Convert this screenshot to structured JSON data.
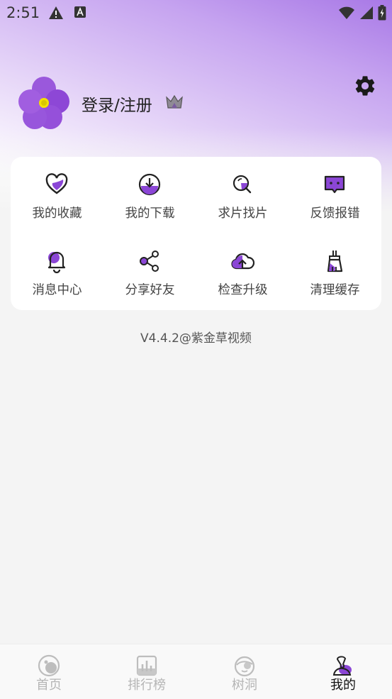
{
  "status_bar": {
    "time": "2:51"
  },
  "profile": {
    "login_label": "登录/注册"
  },
  "menu": {
    "items": [
      {
        "label": "我的收藏",
        "icon": "heart-icon"
      },
      {
        "label": "我的下载",
        "icon": "download-icon"
      },
      {
        "label": "求片找片",
        "icon": "search-film-icon"
      },
      {
        "label": "反馈报错",
        "icon": "feedback-icon"
      },
      {
        "label": "消息中心",
        "icon": "bell-icon"
      },
      {
        "label": "分享好友",
        "icon": "share-icon"
      },
      {
        "label": "检查升级",
        "icon": "cloud-upload-icon"
      },
      {
        "label": "清理缓存",
        "icon": "broom-icon"
      }
    ]
  },
  "version": "V4.4.2@紫金草视频",
  "tabbar": {
    "tabs": [
      {
        "label": "首页",
        "icon": "home-icon"
      },
      {
        "label": "排行榜",
        "icon": "ranking-icon"
      },
      {
        "label": "树洞",
        "icon": "tree-hole-icon"
      },
      {
        "label": "我的",
        "icon": "me-icon"
      }
    ],
    "active_index": 3
  },
  "colors": {
    "accent": "#8b46d6",
    "accent_light": "#a66be2",
    "text": "#222222",
    "muted": "#b5b5b5"
  }
}
